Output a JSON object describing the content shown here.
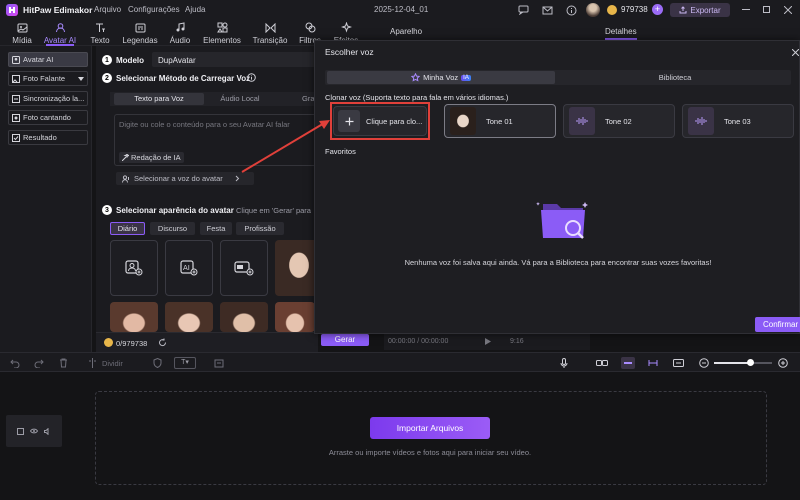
{
  "app": {
    "title": "HitPaw Edimakor",
    "menu": [
      "Arquivo",
      "Configurações",
      "Ajuda"
    ],
    "date": "2025-12-04_01",
    "credits": "979738",
    "export_label": "Exportar"
  },
  "toolbar": [
    {
      "label": "Mídia",
      "icon": "media-icon"
    },
    {
      "label": "Avatar AI",
      "icon": "avatar-icon"
    },
    {
      "label": "Texto",
      "icon": "text-icon"
    },
    {
      "label": "Legendas",
      "icon": "captions-icon"
    },
    {
      "label": "Áudio",
      "icon": "audio-icon"
    },
    {
      "label": "Elementos",
      "icon": "elements-icon"
    },
    {
      "label": "Transição",
      "icon": "transition-icon"
    },
    {
      "label": "Filtros",
      "icon": "filters-icon"
    },
    {
      "label": "Efeitos",
      "icon": "effects-icon"
    }
  ],
  "sidebar": {
    "items": [
      {
        "label": "Avatar AI"
      },
      {
        "label": "Foto Falante"
      },
      {
        "label": "Sincronização la..."
      },
      {
        "label": "Foto cantando"
      },
      {
        "label": "Resultado"
      }
    ]
  },
  "panels": {
    "aparelho": "Aparelho",
    "detalhes": "Detalhes"
  },
  "main": {
    "step1_num": "1",
    "step1_label": "Modelo",
    "model_value": "DupAvatar",
    "step2_num": "2",
    "step2_label": "Selecionar Método de Carregar Voz",
    "tabs": [
      "Texto para Voz",
      "Áudio Local",
      "Gra"
    ],
    "text_placeholder": "Digite ou cole o conteúdo para o seu Avatar AI falar",
    "ai_write": "Redação de IA",
    "select_voice": "Selecionar a voz do avatar",
    "step3_num": "3",
    "step3_label": "Selecionar aparência do avatar",
    "step3_hint": "Clique em 'Gerar' para",
    "styles": [
      "Diário",
      "Discurso",
      "Festa",
      "Profissão"
    ],
    "credits": "0/979738",
    "generate": "Gerar"
  },
  "modal": {
    "title": "Escolher voz",
    "tab_mine": "Minha Voz",
    "ia_badge": "IA",
    "tab_library": "Biblioteca",
    "clone_heading": "Clonar voz (Suporta texto para fala em vários idiomas.)",
    "clone_button": "Clique para clo...",
    "voices": [
      {
        "label": "Tone 01"
      },
      {
        "label": "Tone 02"
      },
      {
        "label": "Tone 03"
      }
    ],
    "favorites_heading": "Favoritos",
    "empty_message": "Nenhuma voz foi salva aqui ainda. Vá para a Biblioteca para encontrar suas vozes favoritas!",
    "confirm": "Confirmar"
  },
  "player": {
    "time": "00:00:00 / 00:00:00",
    "ratio": "9:16"
  },
  "timeline": {
    "undo_label": "Dividir",
    "import_button": "Importar Arquivos",
    "import_hint": "Arraste ou importe vídeos e fotos aqui para iniciar seu vídeo."
  },
  "colors": {
    "accent": "#8b5cf6",
    "highlight": "#e0403a",
    "bg": "#141416"
  }
}
